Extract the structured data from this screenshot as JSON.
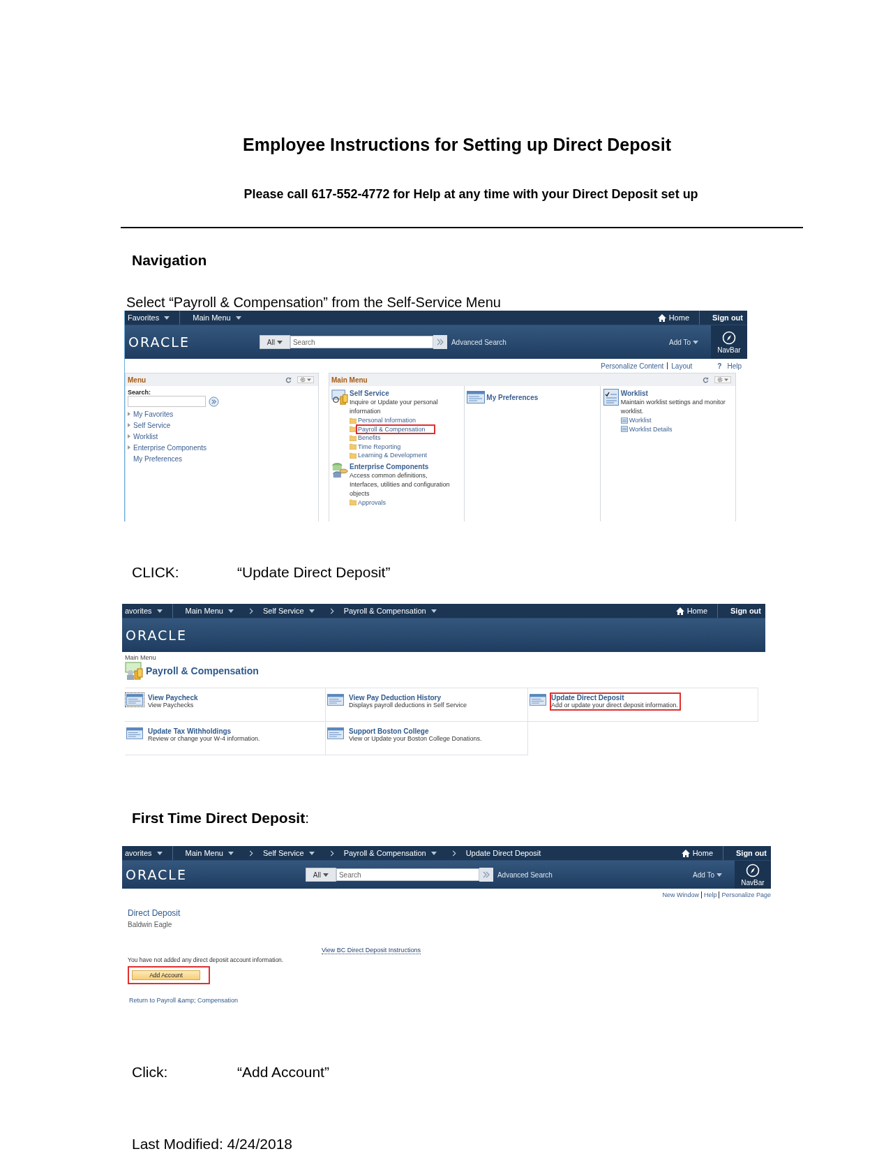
{
  "title": "Employee Instructions for Setting up Direct Deposit",
  "subtitle": "Please call 617-552-4772 for Help at any time with your Direct Deposit set up",
  "navigation_heading": "Navigation",
  "step_1": "Select “Payroll & Compensation” from the Self-Service Menu",
  "screenshot_1": {
    "top_bar": {
      "items": [
        {
          "label": "Favorites",
          "dropdown": true
        },
        {
          "label": "Main Menu",
          "dropdown": true
        }
      ],
      "home": "Home",
      "sign_out": "Sign out"
    },
    "header": {
      "logo": "ORACLE",
      "scope": "All",
      "search_placeholder": "Search",
      "advanced_search": "Advanced Search",
      "add_to": "Add To",
      "navbar": "NavBar"
    },
    "links": {
      "personalize": "Personalize Content",
      "layout": "Layout",
      "help_mark": "?",
      "help": "Help"
    },
    "menu": {
      "title": "Menu",
      "search_label": "Search:",
      "items": [
        {
          "label": "My Favorites",
          "has_children": true
        },
        {
          "label": "Self Service",
          "has_children": true
        },
        {
          "label": "Worklist",
          "has_children": true
        },
        {
          "label": "Enterprise Components",
          "has_children": true
        },
        {
          "label": "My Preferences",
          "has_children": false
        }
      ]
    },
    "main_menu": {
      "title": "Main Menu",
      "columns": [
        {
          "groups": [
            {
              "title": "Self Service",
              "description": "Inquire or Update your personal information",
              "links": [
                {
                  "label": "Personal Information",
                  "highlighted": false
                },
                {
                  "label": "Payroll & Compensation",
                  "highlighted": true
                },
                {
                  "label": "Benefits",
                  "highlighted": false
                },
                {
                  "label": "Time Reporting",
                  "highlighted": false
                },
                {
                  "label": "Learning & Development",
                  "highlighted": false
                }
              ]
            },
            {
              "title": "Enterprise Components",
              "description": "Access common definitions, Interfaces, utilities and configuration objects",
              "links": [
                {
                  "label": "Approvals",
                  "highlighted": false
                }
              ]
            }
          ]
        },
        {
          "groups": [
            {
              "title": "My Preferences"
            }
          ]
        },
        {
          "groups": [
            {
              "title": "Worklist",
              "description": "Maintain worklist settings and monitor worklist.",
              "links": [
                {
                  "label": "Worklist",
                  "highlighted": false
                },
                {
                  "label": "Worklist Details",
                  "highlighted": false
                }
              ]
            }
          ]
        }
      ]
    }
  },
  "step_2": {
    "label": "CLICK:",
    "target": "“Update Direct Deposit”"
  },
  "screenshot_2": {
    "top_bar": {
      "items": [
        {
          "label": "avorites",
          "dropdown": true
        },
        {
          "label": "Main Menu",
          "dropdown": true
        },
        {
          "label": "Self Service",
          "dropdown": true
        },
        {
          "label": "Payroll & Compensation",
          "dropdown": true
        }
      ],
      "home": "Home",
      "sign_out": "Sign out"
    },
    "header": {
      "logo": "ORACLE"
    },
    "breadcrumb": "Main Menu",
    "page_title": "Payroll & Compensation",
    "tiles": [
      {
        "title": "View Paycheck",
        "description": "View Paychecks",
        "highlighted": false,
        "focused": true
      },
      {
        "title": "View Pay Deduction History",
        "description": "Displays payroll deductions in Self Service",
        "highlighted": false,
        "focused": false
      },
      {
        "title": "Update Direct Deposit",
        "description": "Add or update your direct deposit information.",
        "highlighted": true,
        "focused": false
      },
      {
        "title": "Update Tax Withholdings",
        "description": "Review or change your W-4 information.",
        "highlighted": false,
        "focused": false
      },
      {
        "title": "Support Boston College",
        "description": "View or Update your Boston College Donations.",
        "highlighted": false,
        "focused": false
      }
    ]
  },
  "first_time_heading": "**First Time Direct Deposit**:",
  "screenshot_3": {
    "top_bar": {
      "items": [
        {
          "label": "avorites",
          "dropdown": true
        },
        {
          "label": "Main Menu",
          "dropdown": true
        },
        {
          "label": "Self Service",
          "dropdown": true
        },
        {
          "label": "Payroll & Compensation",
          "dropdown": true
        },
        {
          "label": "Update Direct Deposit",
          "dropdown": false
        }
      ],
      "home": "Home",
      "sign_out": "Sign out"
    },
    "header": {
      "logo": "ORACLE",
      "scope": "All",
      "search_placeholder": "Search",
      "advanced_search": "Advanced Search",
      "add_to": "Add To",
      "navbar": "NavBar"
    },
    "links": [
      "New Window",
      "Help",
      "Personalize Page"
    ],
    "page_title": "Direct Deposit",
    "employee_name": "Baldwin Eagle",
    "instructions_link": "View BC Direct Deposit Instructions",
    "message": "You have not added any direct deposit account information.",
    "add_button": {
      "label": "Add Account",
      "highlighted": true
    },
    "return_link": "Return to Payroll &amp; Compensation"
  },
  "step_3": {
    "label": "Click:",
    "target": "“Add Account”"
  },
  "footer": "Last Modified: 4/24/2018"
}
